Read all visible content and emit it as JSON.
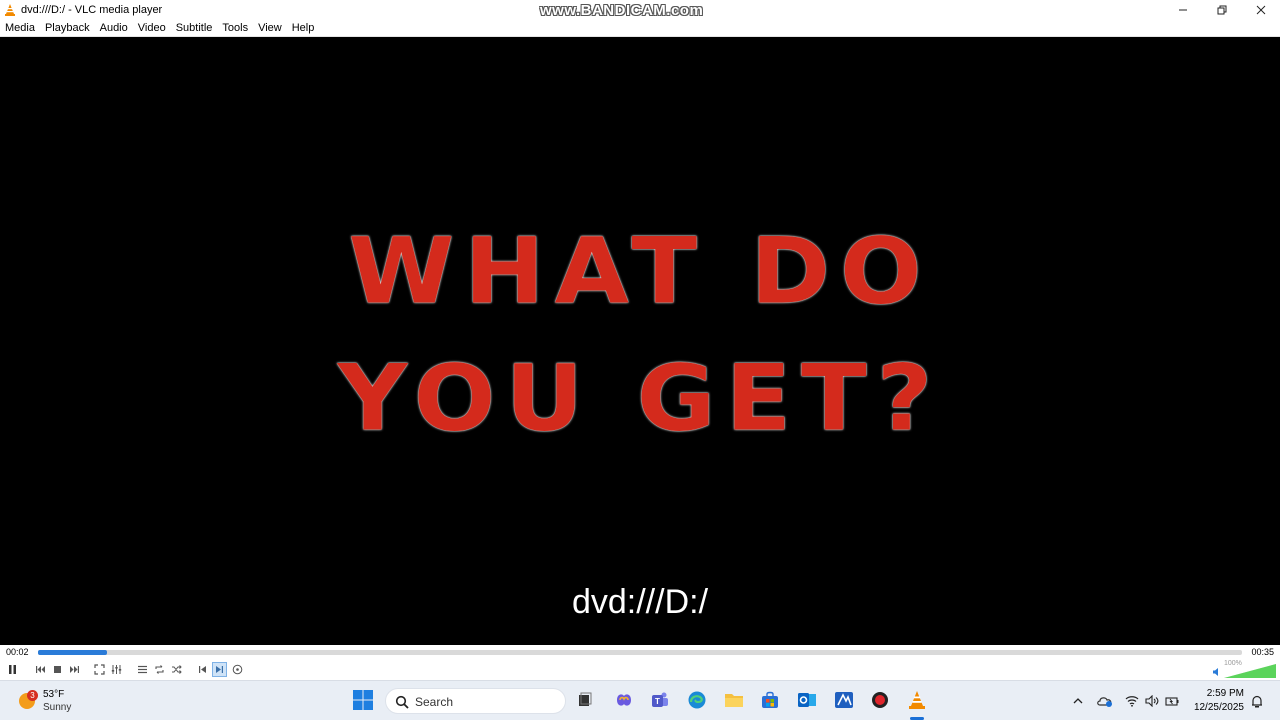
{
  "window": {
    "title": "dvd:///D:/ - VLC media player",
    "watermark": "www.BANDICAM.com"
  },
  "menu": [
    "Media",
    "Playback",
    "Audio",
    "Video",
    "Subtitle",
    "Tools",
    "View",
    "Help"
  ],
  "video": {
    "line1": "WHAT DO",
    "line2": "YOU GET?",
    "osd_text": "dvd:///D:/"
  },
  "seek": {
    "current": "00:02",
    "total": "00:35",
    "progress": 0.057
  },
  "volume": {
    "percent_label": "100%",
    "level": 1.0
  },
  "taskbar": {
    "weather_badge": "3",
    "weather_temp": "53°F",
    "weather_cond": "Sunny",
    "search_placeholder": "Search",
    "time": "2:59 PM",
    "date": "12/25/2025"
  },
  "colors": {
    "accent": "#2a7bd8",
    "movie_title": "#d42a1c"
  }
}
